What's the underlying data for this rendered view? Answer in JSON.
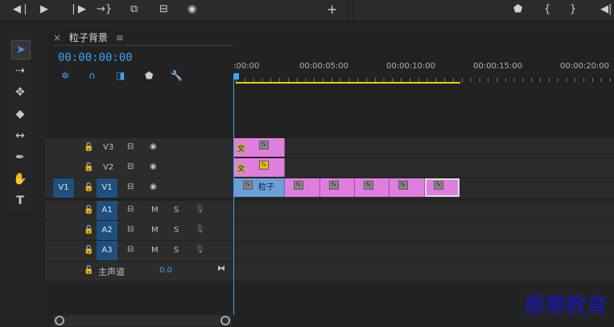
{
  "transport": {
    "icons": [
      "step-back-icon",
      "play-icon",
      "step-forward-icon",
      "go-to-out-icon",
      "insert-icon",
      "overwrite-icon",
      "export-frame-icon",
      "add-icon"
    ]
  },
  "panel": {
    "title": "粒子背景",
    "timecode": "00:00:00:00"
  },
  "ruler": {
    "labels": [
      ":00:00",
      "00:00:05:00",
      "00:00:10:00",
      "00:00:15:00",
      "00:00:20:00"
    ]
  },
  "tracks": {
    "video": [
      {
        "name": "V3"
      },
      {
        "name": "V2"
      },
      {
        "name": "V1",
        "source": "V1"
      }
    ],
    "audio": [
      {
        "name": "A1",
        "m": "M",
        "s": "S"
      },
      {
        "name": "A2",
        "m": "M",
        "s": "S"
      },
      {
        "name": "A3",
        "m": "M",
        "s": "S"
      }
    ],
    "master": {
      "label": "主声道",
      "value": "0.0"
    }
  },
  "clips": {
    "v3_text": "文",
    "v2_text": "文",
    "v1_label": "粒子",
    "fx": "fx"
  },
  "watermark": "最需教育",
  "colors": {
    "accent": "#3ba2f7",
    "clip_pink": "#e07ee0",
    "clip_blue": "#6a9fd8",
    "track_blue": "#1f4f7f"
  }
}
